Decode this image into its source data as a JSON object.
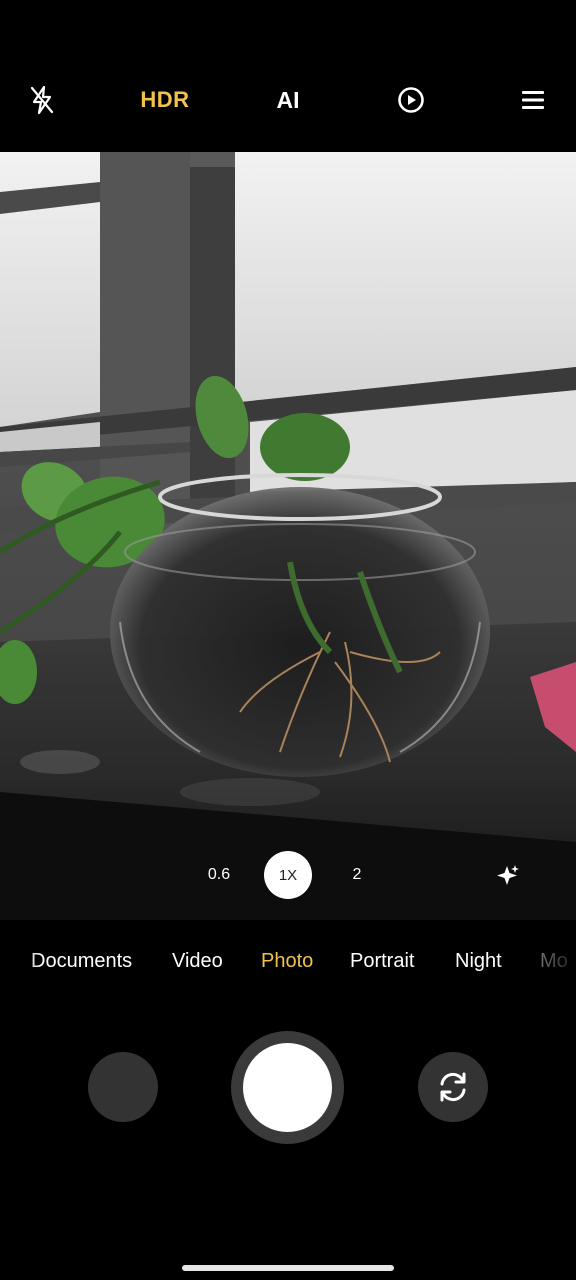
{
  "top_bar": {
    "flash_icon": "flash-off-icon",
    "hdr_label": "HDR",
    "hdr_color": "#f2c14e",
    "ai_label": "AI",
    "live_icon": "live-photo-icon",
    "menu_icon": "menu-icon"
  },
  "zoom": {
    "options": [
      "0.6",
      "1X",
      "2"
    ],
    "selected": "1X",
    "enhance_icon": "sparkle-icon"
  },
  "modes": {
    "items": [
      "Documents",
      "Video",
      "Photo",
      "Portrait",
      "Night",
      "Mo"
    ],
    "selected": "Photo",
    "active_color": "#f2c14e"
  },
  "bottom": {
    "gallery_icon": "gallery-thumbnail",
    "shutter_icon": "shutter-button",
    "switch_icon": "switch-camera-icon"
  }
}
